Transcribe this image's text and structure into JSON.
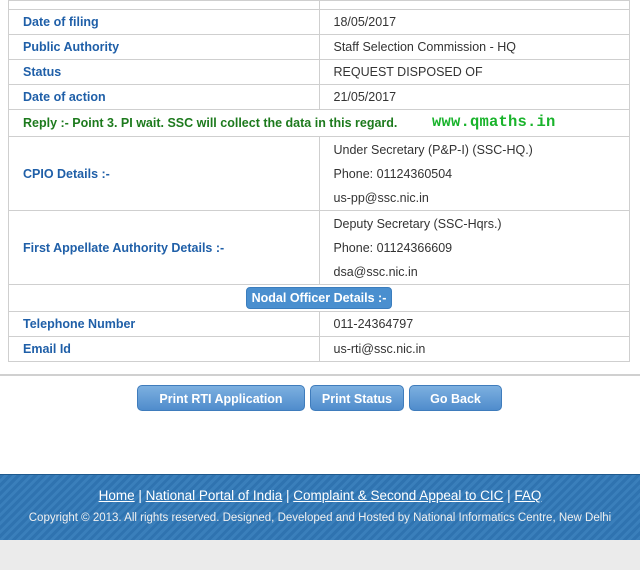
{
  "rows": [
    {
      "label": "Date of filing",
      "value": "18/05/2017"
    },
    {
      "label": "Public Authority",
      "value": "Staff Selection Commission - HQ"
    },
    {
      "label": "Status",
      "value": "REQUEST DISPOSED OF"
    },
    {
      "label": "Date of action",
      "value": "21/05/2017"
    }
  ],
  "reply": {
    "text": "Reply :- Point 3. PI wait. SSC will collect the data in this regard.",
    "watermark": "www.qmaths.in"
  },
  "cpio": {
    "label": "CPIO Details :-",
    "designation": "Under Secretary (P&P-I) (SSC-HQ.)",
    "phone": "Phone: 01124360504",
    "email": "us-pp@ssc.nic.in"
  },
  "faa": {
    "label": "First Appellate Authority Details :-",
    "designation": "Deputy Secretary (SSC-Hqrs.)",
    "phone": "Phone: 01124366609",
    "email": "dsa@ssc.nic.in"
  },
  "nodal": {
    "header": "Nodal Officer Details :-",
    "tel_label": "Telephone Number",
    "tel_value": "011-24364797",
    "email_label": "Email Id",
    "email_value": "us-rti@ssc.nic.in"
  },
  "buttons": {
    "print_app": "Print RTI Application",
    "print_status": "Print Status",
    "go_back": "Go Back"
  },
  "footer": {
    "links": [
      "Home",
      "National Portal of India",
      "Complaint & Second Appeal to CIC",
      "FAQ"
    ],
    "copyright": "Copyright © 2013. All rights reserved. Designed, Developed and Hosted by National Informatics Centre, New Delhi"
  },
  "colors": {
    "label_blue": "#1f5fa8",
    "reply_green": "#1d7a1d",
    "watermark_green": "#19b32b",
    "button_blue": "#4f8ccc",
    "footer_blue": "#2f73b0"
  }
}
